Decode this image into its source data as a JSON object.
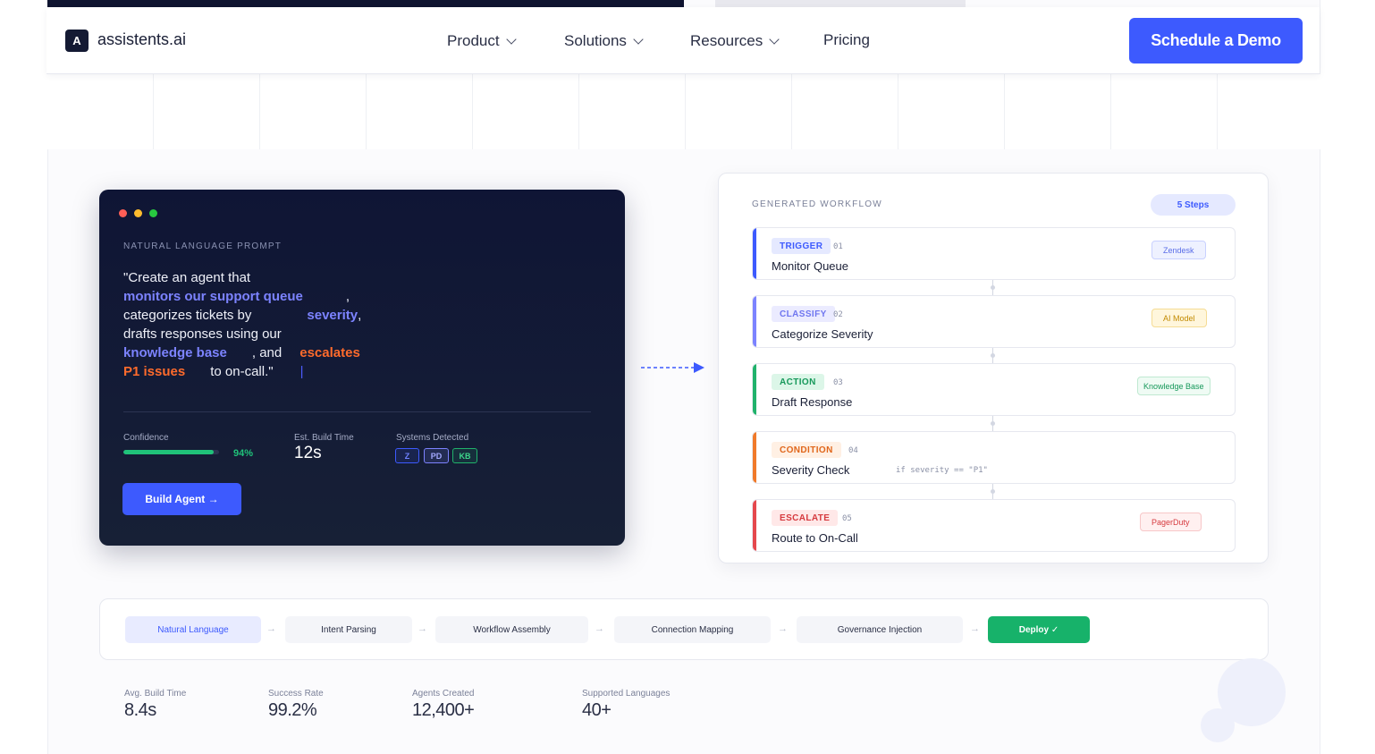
{
  "nav": {
    "logo_letter": "A",
    "brand": "assistents.ai",
    "menu": [
      {
        "label": "Product",
        "has_dropdown": true
      },
      {
        "label": "Solutions",
        "has_dropdown": true
      },
      {
        "label": "Resources",
        "has_dropdown": true
      },
      {
        "label": "Pricing",
        "has_dropdown": false
      }
    ],
    "cta": "Schedule a Demo"
  },
  "prompt": {
    "label": "NATURAL LANGUAGE PROMPT",
    "text_parts": {
      "p1": "\"Create an agent that",
      "h1": "monitors our support queue",
      "p2": ",",
      "p3": "categorizes tickets by",
      "h2": "severity",
      "p4": ",",
      "p5": "drafts responses using our",
      "h3": "knowledge base",
      "p6": ", and",
      "h4": "escalates",
      "h5": "P1 issues",
      "p7": "to on-call.\"",
      "caret": "|"
    },
    "confidence_label": "Confidence",
    "confidence_value": 94,
    "confidence_text": "94%",
    "build_time_label": "Est. Build Time",
    "build_time": "12s",
    "systems_label": "Systems Detected",
    "systems": [
      "Z",
      "PD",
      "KB"
    ],
    "build_button": "Build Agent →"
  },
  "workflow": {
    "title": "GENERATED WORKFLOW",
    "badge": "5 Steps",
    "steps": [
      {
        "tag": "TRIGGER",
        "num": "01",
        "name": "Monitor Queue",
        "system": "Zendesk",
        "code": ""
      },
      {
        "tag": "CLASSIFY",
        "num": "02",
        "name": "Categorize Severity",
        "system": "AI Model",
        "code": ""
      },
      {
        "tag": "ACTION",
        "num": "03",
        "name": "Draft Response",
        "system": "Knowledge Base",
        "code": ""
      },
      {
        "tag": "CONDITION",
        "num": "04",
        "name": "Severity Check",
        "system": "",
        "code": "if severity == \"P1\""
      },
      {
        "tag": "ESCALATE",
        "num": "05",
        "name": "Route to On-Call",
        "system": "PagerDuty",
        "code": ""
      }
    ],
    "colors": {
      "trigger": "#3d5afe",
      "classify": "#7c83ff",
      "action": "#20b26b",
      "condition": "#f07a2a",
      "escalate": "#e5484d"
    }
  },
  "pipeline": {
    "steps": [
      "Natural Language",
      "Intent Parsing",
      "Workflow Assembly",
      "Connection Mapping",
      "Governance Injection",
      "Deploy ✓"
    ],
    "arrow": "→"
  },
  "stats": [
    {
      "label": "Avg. Build Time",
      "value": "8.4s"
    },
    {
      "label": "Success Rate",
      "value": "99.2%"
    },
    {
      "label": "Agents Created",
      "value": "12,400+"
    },
    {
      "label": "Supported Languages",
      "value": "40+"
    }
  ]
}
